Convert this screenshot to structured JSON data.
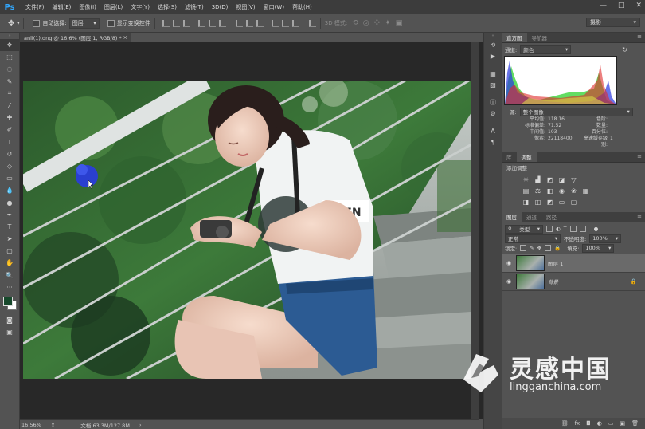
{
  "app": {
    "logo": "Ps"
  },
  "menu": [
    "文件(F)",
    "编辑(E)",
    "图像(I)",
    "图层(L)",
    "文字(Y)",
    "选择(S)",
    "滤镜(T)",
    "3D(D)",
    "视图(V)",
    "窗口(W)",
    "帮助(H)"
  ],
  "window_controls": {
    "minimize": "—",
    "maximize": "□",
    "close": "✕"
  },
  "options": {
    "auto_select_label": "自动选择:",
    "auto_select_value": "图层",
    "show_transform_label": "显示变换控件",
    "mode_3d_label": "3D 模式:",
    "workspace": "摄影"
  },
  "document": {
    "tab_title": "anli(1).dng @ 16.6% (图层 1, RGB/8) *",
    "close": "×",
    "zoom": "16.56%",
    "doc_size": "文档:63.3M/127.8M"
  },
  "histogram": {
    "tabs": [
      "直方图",
      "导航器"
    ],
    "channel_label": "通道:",
    "channel_value": "颜色",
    "source_label": "源:",
    "source_value": "整个图像",
    "stats_left": [
      {
        "label": "平均值:",
        "value": "118.16"
      },
      {
        "label": "标准偏差:",
        "value": "71.52"
      },
      {
        "label": "中间值:",
        "value": "103"
      },
      {
        "label": "像素:",
        "value": "22118400"
      }
    ],
    "stats_right": [
      {
        "label": "色阶:",
        "value": ""
      },
      {
        "label": "数量:",
        "value": ""
      },
      {
        "label": "百分位:",
        "value": ""
      },
      {
        "label": "高速缓存级别:",
        "value": "1"
      }
    ]
  },
  "adjustments": {
    "tabs": [
      "库",
      "调整"
    ],
    "title": "添加调整"
  },
  "layers": {
    "tabs": [
      "图层",
      "通道",
      "路径"
    ],
    "filter_kind": "类型",
    "blend_mode": "正常",
    "opacity_label": "不透明度:",
    "opacity_value": "100%",
    "lock_label": "锁定:",
    "fill_label": "填充:",
    "fill_value": "100%",
    "items": [
      {
        "name": "图层 1",
        "selected": true
      },
      {
        "name": "背景",
        "selected": false
      }
    ]
  },
  "watermark": {
    "title": "灵感中国",
    "url": "lingganchina.com"
  },
  "colors": {
    "accent": "#31a8ff",
    "foreground": "#17492c",
    "background": "#ffffff"
  }
}
